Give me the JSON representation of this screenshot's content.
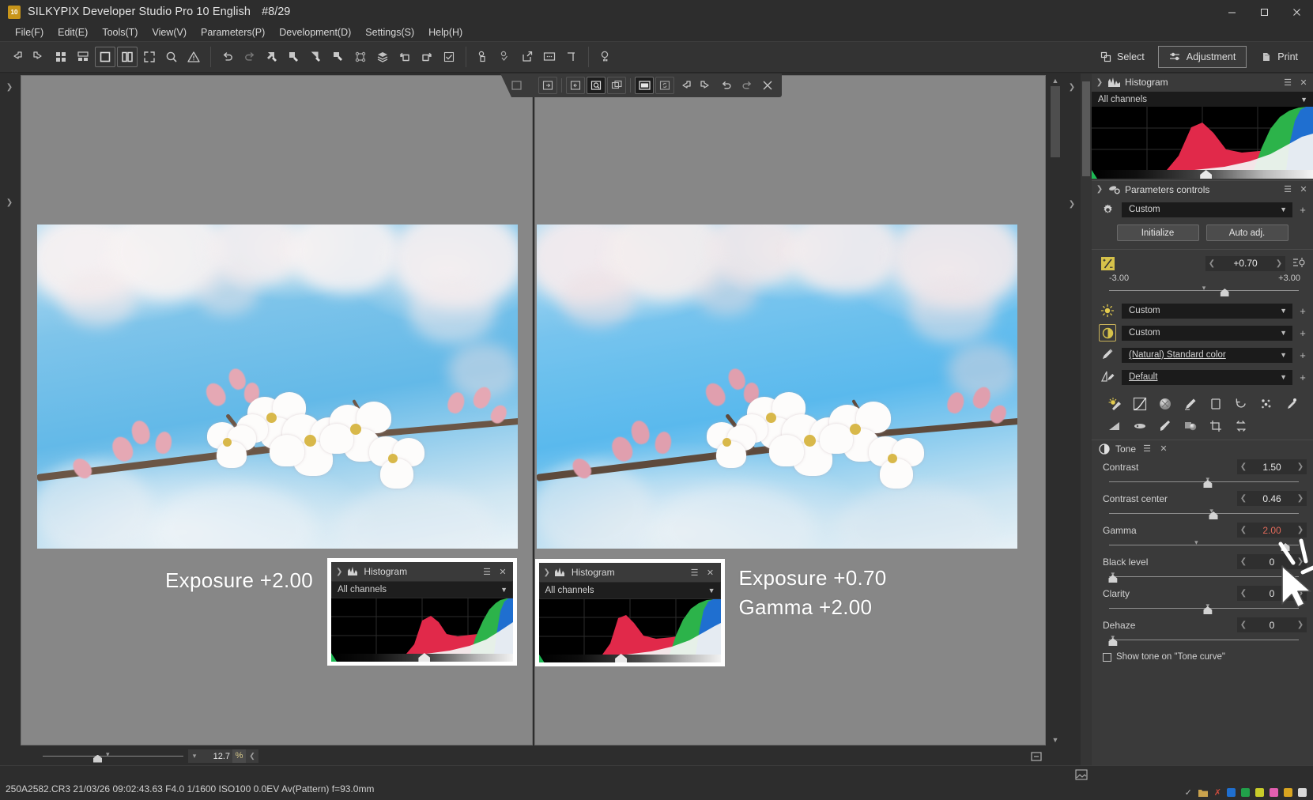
{
  "window": {
    "title": "SILKYPIX Developer Studio Pro 10 English",
    "counter": "#8/29",
    "logo_text": "10",
    "minimize": "─",
    "maximize": "☐",
    "close": "✕"
  },
  "menu": [
    {
      "label": "File(F)"
    },
    {
      "label": "Edit(E)"
    },
    {
      "label": "Tools(T)"
    },
    {
      "label": "View(V)"
    },
    {
      "label": "Parameters(P)"
    },
    {
      "label": "Development(D)"
    },
    {
      "label": "Settings(S)"
    },
    {
      "label": "Help(H)"
    }
  ],
  "toolbar": {
    "mode_buttons": [
      {
        "label": "Select",
        "icon": "select-icon",
        "active": false
      },
      {
        "label": "Adjustment",
        "icon": "adjustment-icon",
        "active": true
      },
      {
        "label": "Print",
        "icon": "print-icon",
        "active": false
      }
    ]
  },
  "viewer": {
    "left_image": {
      "overlay_label": "Exposure +2.00",
      "histogram": {
        "title": "Histogram",
        "channel": "All channels"
      }
    },
    "right_image": {
      "overlay_label_line1": "Exposure +0.70",
      "overlay_label_line2": "Gamma +2.00",
      "histogram": {
        "title": "Histogram",
        "channel": "All channels"
      }
    },
    "zoom": {
      "value": "12.7",
      "unit": "%"
    }
  },
  "right_panel": {
    "histogram": {
      "title": "Histogram",
      "channel": "All channels"
    },
    "parameters_controls": {
      "title": "Parameters controls",
      "taste_value": "Custom",
      "initialize_label": "Initialize",
      "auto_adj_label": "Auto adj.",
      "exposure": {
        "value": "+0.70",
        "min_label": "-3.00",
        "max_label": "+3.00"
      },
      "white_balance_value": "Custom",
      "tone_preset_value": "Custom",
      "color_mode_value": "(Natural) Standard color",
      "sharpness_value": "Default"
    },
    "tone": {
      "title": "Tone",
      "rows": [
        {
          "label": "Contrast",
          "value": "1.50",
          "warn": false,
          "knob": 52
        },
        {
          "label": "Contrast center",
          "value": "0.46",
          "warn": false,
          "knob": 54
        },
        {
          "label": "Gamma",
          "value": "2.00",
          "warn": true,
          "knob": 46
        },
        {
          "label": "Black level",
          "value": "0",
          "warn": false,
          "knob": 2
        },
        {
          "label": "Clarity",
          "value": "0",
          "warn": false,
          "knob": 52
        },
        {
          "label": "Dehaze",
          "value": "0",
          "warn": false,
          "knob": 2
        }
      ],
      "checkbox_label": "Show tone on \"Tone curve\"",
      "checkbox_checked": false
    }
  },
  "status_bar": {
    "info": "250A2582.CR3 21/03/26 09:02:43.63 F4.0 1/1600 ISO100  0.0EV Av(Pattern) f=93.0mm",
    "color_chips": [
      "#1f6fd0",
      "#21a04a",
      "#c8cc2a",
      "#e25fb0",
      "#d9a520",
      "#d8d8d8"
    ],
    "marks": [
      "✓",
      "■",
      "✕"
    ]
  },
  "colors": {
    "accent_yellow": "#d6c24a",
    "warn_red": "#e06a5a",
    "panel_bg": "#3a3a3a",
    "window_bg": "#2d2d2d",
    "canvas_gray": "#878787"
  }
}
